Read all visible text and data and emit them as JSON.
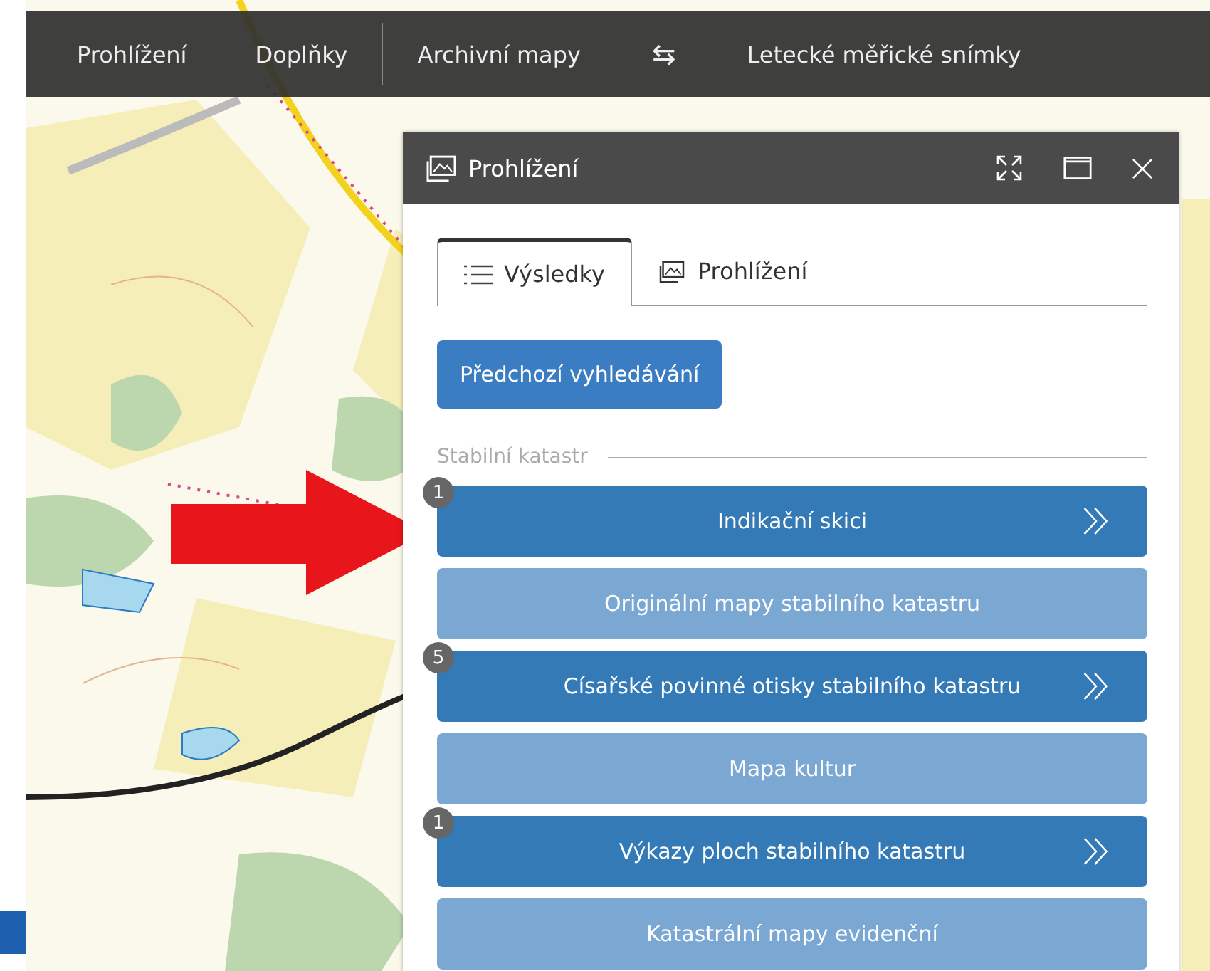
{
  "toolbar": {
    "items": [
      {
        "label": "Prohlížení",
        "kind": "text"
      },
      {
        "label": "Doplňky",
        "kind": "text"
      },
      {
        "label": "Archivní mapy",
        "kind": "text"
      },
      {
        "label": "⇆",
        "kind": "glyph"
      },
      {
        "label": "Letecké měřické snímky",
        "kind": "text"
      }
    ]
  },
  "panel": {
    "title": "Prohlížení",
    "tabs": [
      {
        "label": "Výsledky",
        "kind": "list",
        "selected": true
      },
      {
        "label": "Prohlížení",
        "kind": "images",
        "selected": false
      }
    ],
    "back_button": "Předchozí vyhledávání",
    "section": "Stabilní katastr",
    "items": [
      {
        "label": "Indikační skici",
        "badge": "1",
        "expandable": true
      },
      {
        "label": "Originální mapy stabilního katastru",
        "expandable": false
      },
      {
        "label": "Císařské povinné otisky stabilního katastru",
        "badge": "5",
        "expandable": true
      },
      {
        "label": "Mapa kultur",
        "expandable": false
      },
      {
        "label": "Výkazy ploch stabilního katastru",
        "badge": "1",
        "expandable": true
      },
      {
        "label": "Katastrální mapy evidenční",
        "expandable": false
      }
    ]
  }
}
